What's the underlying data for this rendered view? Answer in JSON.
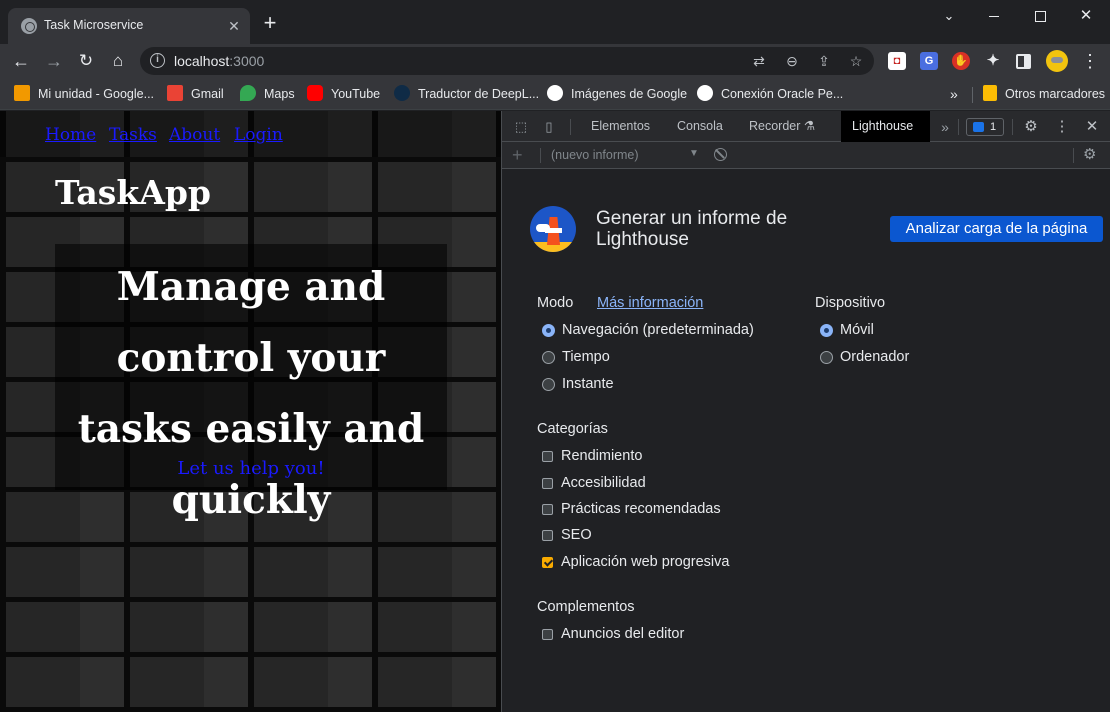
{
  "browser": {
    "tab_title": "Task Microservice",
    "new_tab_symbol": "+",
    "url_host": "localhost",
    "url_port": ":3000",
    "bookmarks": [
      "Mi unidad - Google...",
      "Gmail",
      "Maps",
      "YouTube",
      "Traductor de DeepL...",
      "Imágenes de Google",
      "Conexión Oracle Pe...",
      "Otros marcadores"
    ],
    "bookmarks_overflow": "»"
  },
  "page": {
    "nav": [
      "Home",
      "Tasks",
      "About",
      "Login"
    ],
    "brand": "TaskApp",
    "hero_title": "Manage and control your tasks easily and quickly",
    "hero_cta": "Let us help you!",
    "link_color": "#1a1aff"
  },
  "devtools": {
    "tabs": [
      "Elementos",
      "Consola",
      "Recorder",
      "Lighthouse"
    ],
    "active_tab": "Lighthouse",
    "issues_count": "1",
    "report_select": "(nuevo informe)",
    "lighthouse": {
      "title": "Generar un informe de Lighthouse",
      "analyze_button": "Analizar carga de la página",
      "mode_label": "Modo",
      "mode_link": "Más información",
      "modes": [
        {
          "label": "Navegación (predeterminada)",
          "selected": true
        },
        {
          "label": "Tiempo",
          "selected": false
        },
        {
          "label": "Instante",
          "selected": false
        }
      ],
      "device_label": "Dispositivo",
      "devices": [
        {
          "label": "Móvil",
          "selected": true
        },
        {
          "label": "Ordenador",
          "selected": false
        }
      ],
      "categories_label": "Categorías",
      "categories": [
        {
          "label": "Rendimiento",
          "checked": false
        },
        {
          "label": "Accesibilidad",
          "checked": false
        },
        {
          "label": "Prácticas recomendadas",
          "checked": false
        },
        {
          "label": "SEO",
          "checked": false
        },
        {
          "label": "Aplicación web progresiva",
          "checked": true
        }
      ],
      "plugins_label": "Complementos",
      "plugins": [
        {
          "label": "Anuncios del editor",
          "checked": false
        }
      ],
      "accent_color": "#0b57d0",
      "check_color": "#f9ab00"
    }
  }
}
